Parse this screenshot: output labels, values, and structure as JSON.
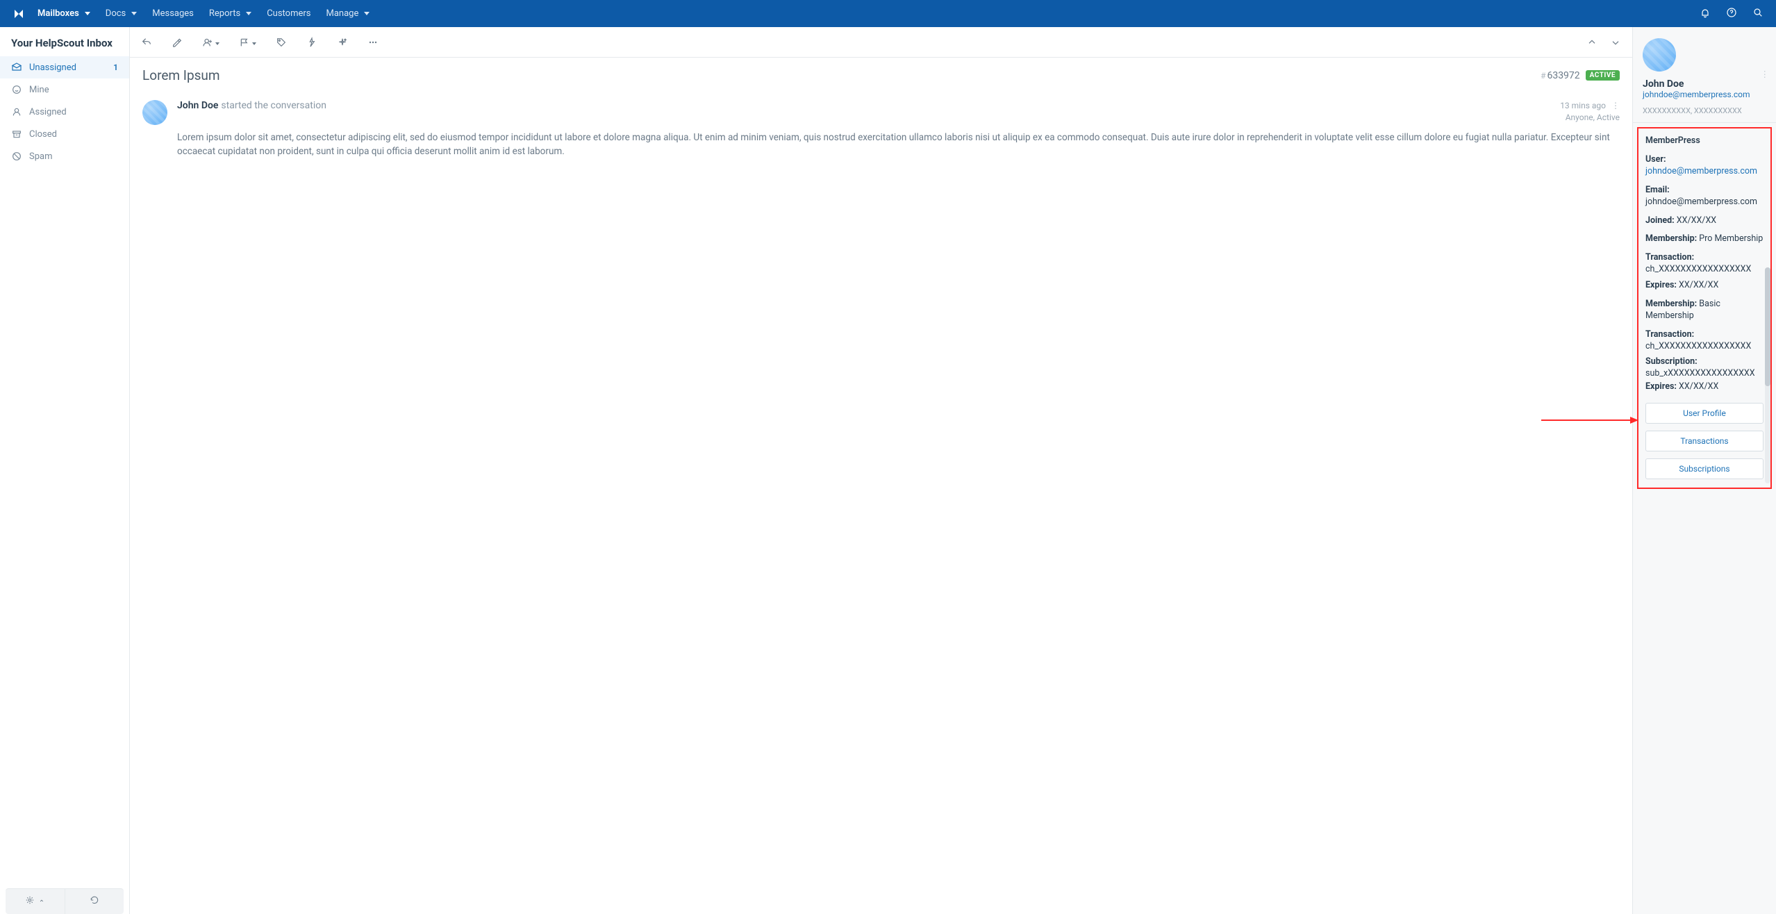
{
  "topnav": {
    "items": [
      {
        "label": "Mailboxes",
        "dropdown": true,
        "active": true
      },
      {
        "label": "Docs",
        "dropdown": true
      },
      {
        "label": "Messages"
      },
      {
        "label": "Reports",
        "dropdown": true
      },
      {
        "label": "Customers"
      },
      {
        "label": "Manage",
        "dropdown": true
      }
    ]
  },
  "sidebar": {
    "title": "Your HelpScout Inbox",
    "folders": [
      {
        "icon": "inbox",
        "label": "Unassigned",
        "count": "1",
        "active": true
      },
      {
        "icon": "user",
        "label": "Mine"
      },
      {
        "icon": "person",
        "label": "Assigned"
      },
      {
        "icon": "archive",
        "label": "Closed"
      },
      {
        "icon": "spam",
        "label": "Spam"
      }
    ]
  },
  "conversation": {
    "subject": "Lorem Ipsum",
    "number": "633972",
    "status": "ACTIVE",
    "message": {
      "author": "John Doe",
      "action": "started the conversation",
      "time": "13 mins ago",
      "visibility": "Anyone, Active",
      "body": "Lorem ipsum dolor sit amet, consectetur adipiscing elit, sed do eiusmod tempor incididunt ut labore et dolore magna aliqua. Ut enim ad minim veniam, quis nostrud exercitation ullamco laboris nisi ut aliquip ex ea commodo consequat. Duis aute irure dolor in reprehenderit in voluptate velit esse cillum dolore eu fugiat nulla pariatur. Excepteur sint occaecat cupidatat non proident, sunt in culpa qui officia deserunt mollit anim id est laborum."
    }
  },
  "customer": {
    "name": "John Doe",
    "email": "johndoe@memberpress.com",
    "extra": "XXXXXXXXXX, XXXXXXXXXX"
  },
  "memberpress": {
    "title": "MemberPress",
    "user_label": "User:",
    "user_value": "johndoe@memberpress.com",
    "email_label": "Email:",
    "email_value": "johndoe@memberpress.com",
    "joined_label": "Joined:",
    "joined_value": "XX/XX/XX",
    "m1_label": "Membership:",
    "m1_value": "Pro Membership",
    "t1_label": "Transaction:",
    "t1_value": "ch_XXXXXXXXXXXXXXXXX",
    "exp1_label": "Expires:",
    "exp1_value": "XX/XX/XX",
    "m2_label": "Membership:",
    "m2_value": "Basic Membership",
    "t2_label": "Transaction:",
    "t2_value": "ch_XXXXXXXXXXXXXXXXX",
    "sub_label": "Subscription:",
    "sub_value": "sub_xXXXXXXXXXXXXXXXX",
    "exp2_label": "Expires:",
    "exp2_value": "XX/XX/XX",
    "buttons": {
      "profile": "User Profile",
      "transactions": "Transactions",
      "subscriptions": "Subscriptions"
    }
  }
}
